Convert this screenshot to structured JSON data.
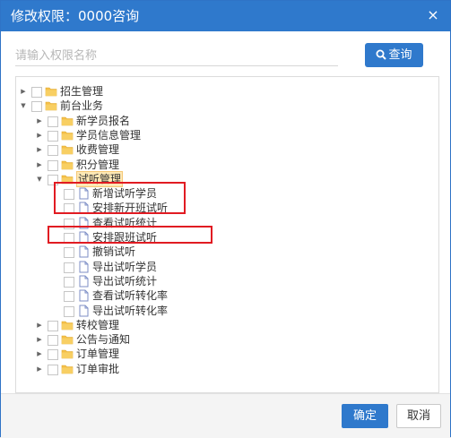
{
  "dialog": {
    "title": "修改权限：0000咨询",
    "close_icon": "×"
  },
  "search": {
    "placeholder": "请输入权限名称",
    "value": "",
    "button_label": "查询",
    "button_icon": "search-icon"
  },
  "tree": {
    "nodes": [
      {
        "label": "招生管理",
        "type": "folder",
        "state": "collapsed",
        "level": 0
      },
      {
        "label": "前台业务",
        "type": "folder",
        "state": "expanded",
        "level": 0
      },
      {
        "label": "新学员报名",
        "type": "folder",
        "state": "collapsed",
        "level": 1
      },
      {
        "label": "学员信息管理",
        "type": "folder",
        "state": "collapsed",
        "level": 1
      },
      {
        "label": "收费管理",
        "type": "folder",
        "state": "collapsed",
        "level": 1
      },
      {
        "label": "积分管理",
        "type": "folder",
        "state": "collapsed",
        "level": 1
      },
      {
        "label": "试听管理",
        "type": "folder",
        "state": "expanded",
        "level": 1,
        "selected": true
      },
      {
        "label": "新增试听学员",
        "type": "file",
        "level": 2,
        "highlighted": true
      },
      {
        "label": "安排新开班试听",
        "type": "file",
        "level": 2,
        "highlighted": true
      },
      {
        "label": "查看试听统计",
        "type": "file",
        "level": 2
      },
      {
        "label": "安排跟班试听",
        "type": "file",
        "level": 2,
        "highlighted": true
      },
      {
        "label": "撤销试听",
        "type": "file",
        "level": 2
      },
      {
        "label": "导出试听学员",
        "type": "file",
        "level": 2
      },
      {
        "label": "导出试听统计",
        "type": "file",
        "level": 2
      },
      {
        "label": "查看试听转化率",
        "type": "file",
        "level": 2
      },
      {
        "label": "导出试听转化率",
        "type": "file",
        "level": 2
      },
      {
        "label": "转校管理",
        "type": "folder",
        "state": "collapsed",
        "level": 1
      },
      {
        "label": "公告与通知",
        "type": "folder",
        "state": "collapsed",
        "level": 1
      },
      {
        "label": "订单管理",
        "type": "folder",
        "state": "collapsed",
        "level": 1
      },
      {
        "label": "订单审批",
        "type": "folder",
        "state": "collapsed",
        "level": 1
      }
    ]
  },
  "footer": {
    "ok_label": "确定",
    "cancel_label": "取消"
  },
  "colors": {
    "primary": "#2f79cc",
    "highlight_border": "#e11b22",
    "selected_bg": "#fde8b5",
    "folder": "#f5c04a"
  }
}
